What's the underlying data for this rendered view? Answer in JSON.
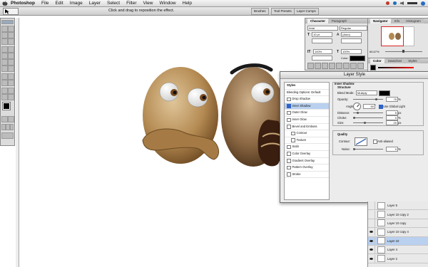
{
  "menubar": {
    "app": "Photoshop",
    "items": [
      "File",
      "Edit",
      "Image",
      "Layer",
      "Select",
      "Filter",
      "View",
      "Window",
      "Help"
    ]
  },
  "options_bar": {
    "hint": "Click and drag to reposition the effect.",
    "wells": [
      "Brushes",
      "Tool Presets",
      "Layer Comps"
    ]
  },
  "character_panel": {
    "tabs": [
      "Character",
      "Paragraph"
    ],
    "font": "Arial",
    "style": "Regular",
    "size": "10 pt",
    "leading": "(Auto)",
    "scale_v": "100%",
    "scale_h": "100%",
    "color_label": "Color:"
  },
  "navigator_panel": {
    "tabs": [
      "Navigator",
      "Info",
      "Histogram"
    ],
    "zoom": "66.67%"
  },
  "color_panel": {
    "tabs": [
      "Color",
      "Swatches",
      "Styles"
    ]
  },
  "dialog": {
    "title": "Layer Style",
    "styles_header": "Styles",
    "list": [
      {
        "label": "Blending Options: Default",
        "checkbox": false,
        "checked": false,
        "selected": false,
        "indent": false
      },
      {
        "label": "Drop Shadow",
        "checkbox": true,
        "checked": false,
        "selected": false,
        "indent": false
      },
      {
        "label": "Inner Shadow",
        "checkbox": true,
        "checked": true,
        "selected": true,
        "indent": false
      },
      {
        "label": "Outer Glow",
        "checkbox": true,
        "checked": false,
        "selected": false,
        "indent": false
      },
      {
        "label": "Inner Glow",
        "checkbox": true,
        "checked": false,
        "selected": false,
        "indent": false
      },
      {
        "label": "Bevel and Emboss",
        "checkbox": true,
        "checked": false,
        "selected": false,
        "indent": false
      },
      {
        "label": "Contour",
        "checkbox": true,
        "checked": false,
        "selected": false,
        "indent": true
      },
      {
        "label": "Texture",
        "checkbox": true,
        "checked": false,
        "selected": false,
        "indent": true
      },
      {
        "label": "Satin",
        "checkbox": true,
        "checked": false,
        "selected": false,
        "indent": false
      },
      {
        "label": "Color Overlay",
        "checkbox": true,
        "checked": false,
        "selected": false,
        "indent": false
      },
      {
        "label": "Gradient Overlay",
        "checkbox": true,
        "checked": false,
        "selected": false,
        "indent": false
      },
      {
        "label": "Pattern Overlay",
        "checkbox": true,
        "checked": false,
        "selected": false,
        "indent": false
      },
      {
        "label": "Stroke",
        "checkbox": true,
        "checked": false,
        "selected": false,
        "indent": false
      }
    ],
    "inner_shadow": {
      "title": "Inner Shadow",
      "structure": "Structure",
      "blend_mode_label": "Blend Mode:",
      "blend_mode": "Multiply",
      "opacity_label": "Opacity:",
      "opacity": "75",
      "angle_label": "Angle:",
      "angle": "50",
      "global_light_label": "Use Global Light",
      "distance_label": "Distance:",
      "distance": "5",
      "choke_label": "Choke:",
      "choke": "0",
      "size_label": "Size:",
      "size": "20",
      "quality": "Quality",
      "contour_label": "Contour:",
      "anti_alias_label": "Anti-aliased",
      "noise_label": "Noise:",
      "noise": "0",
      "pct": "%",
      "deg": "°",
      "px": "px",
      "shadow_color": "#000000"
    },
    "selected_fill": "#b9d0ef",
    "check_color": "#2f63c7"
  },
  "layers_panel": {
    "rows": [
      {
        "name": "Layer 5",
        "visible": false,
        "selected": false
      },
      {
        "name": "Layer 10 copy 2",
        "visible": false,
        "selected": false
      },
      {
        "name": "Layer 10 copy",
        "visible": false,
        "selected": false
      },
      {
        "name": "Layer 10 copy 4",
        "visible": true,
        "selected": false
      },
      {
        "name": "Layer 10",
        "visible": true,
        "selected": true
      },
      {
        "name": "Layer 4",
        "visible": true,
        "selected": false
      },
      {
        "name": "Layer 2",
        "visible": true,
        "selected": false
      }
    ]
  }
}
